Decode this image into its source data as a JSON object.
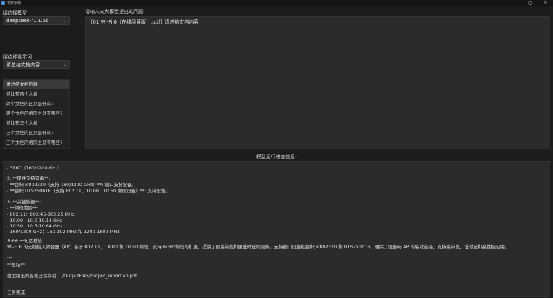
{
  "window": {
    "title": "专家系统",
    "minimize": "—",
    "maximize": "▢",
    "close": "✕"
  },
  "model_select": {
    "label": "请选择模型",
    "value": "deepseek-r1:1.5b"
  },
  "prompt_select": {
    "label": "请选择提示词",
    "value": "请总结文档内容"
  },
  "prompt_list": [
    "请总结文档内容",
    "请比较两个文档",
    "两个文档的区别是什么?",
    "两个文档的相同之处有哪些?",
    "请比较三个文档",
    "三个文档的区别是什么?",
    "三个文档的相同之处有哪些?"
  ],
  "question": {
    "label": "请输入向大模型提出的问题:",
    "value": "{01 Wi-Fi 6（在线阅读版）.pdf} 请总结文档内容"
  },
  "progress": {
    "label": "模型运行进度信息:"
  },
  "log_lines": [
    " - 3860（160/1200 GHz）",
    "",
    "2. **硬件支持设备**:",
    " - **台积 ic802320（支持 160/1200 GHz）**: 端口支持设备。",
    " - **台积 UTS250b16（支持 802.11、10.00、10.50 频段设备）**: 支持设备。",
    "",
    "3. **关键数据**:",
    " - **频段范围**:",
    "  - 802.11：802.45-803.25 MHz",
    "  - 10.00：10.0-10.14 GHz",
    "  - 10.50：10.5-10.64 GHz",
    "  - 160/1200 GHz：160-192 MHz 和 1200-1600 MHz",
    "",
    "### 一句话总结",
    "Wi-Fi 6 的无线接入聚合器（AP）基于 802.11、10.00 和 10.50 频段，支持 6GHz频段的扩展，提供了更高带宽和更低时延的服务。支持额口设备如台积 ic802320 和 UTS250b16，确保了设备与 AP 的高效连接，支持高带宽、低时延和高性能应用。",
    "",
    "---",
    "**总结**",
    "",
    "模型给出的答案已保存到: ../OutputFiles/output_reportlab.pdf",
    "",
    "",
    "任务完成!"
  ]
}
